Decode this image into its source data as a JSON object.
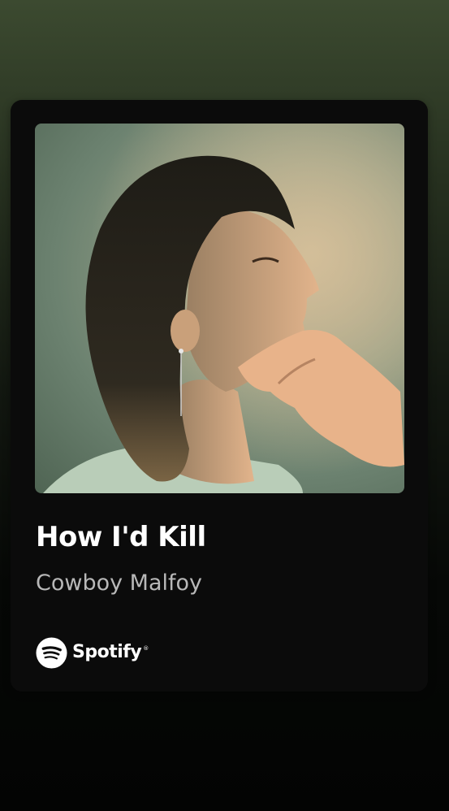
{
  "track": {
    "title": "How I'd Kill",
    "artist": "Cowboy Malfoy"
  },
  "brand": {
    "name": "Spotify",
    "registered": "®",
    "icon": "spotify-logo-icon"
  },
  "colors": {
    "background_top": "#3c4a30",
    "background_bottom": "#030403",
    "card": "#0b0b0b",
    "title": "#ffffff",
    "artist": "#b8b8b8"
  }
}
